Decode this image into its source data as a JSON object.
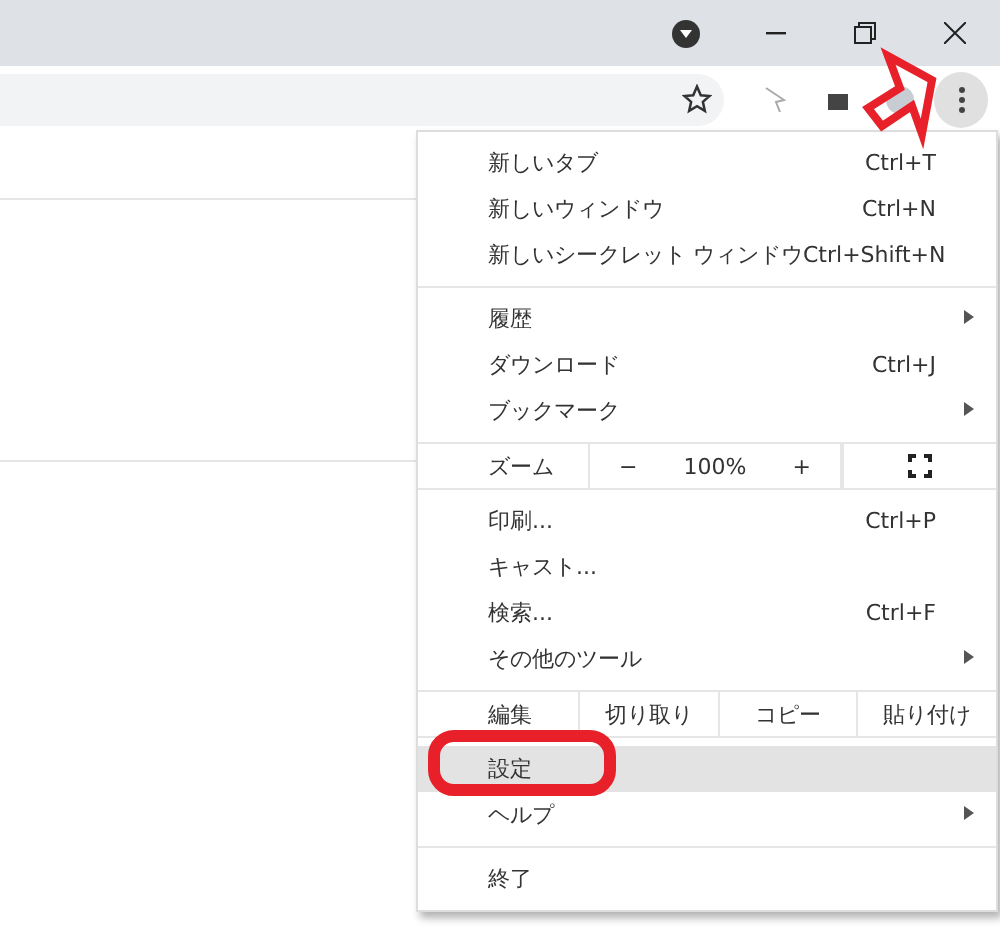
{
  "toolbar": {
    "menu_button_active": true
  },
  "menu": {
    "items": [
      {
        "kind": "item",
        "label": "新しいタブ",
        "shortcut": "Ctrl+T",
        "submenu": false,
        "selected": false
      },
      {
        "kind": "item",
        "label": "新しいウィンドウ",
        "shortcut": "Ctrl+N",
        "submenu": false,
        "selected": false
      },
      {
        "kind": "item",
        "label": "新しいシークレット ウィンドウ",
        "shortcut": "Ctrl+Shift+N",
        "submenu": false,
        "selected": false
      },
      {
        "kind": "separator"
      },
      {
        "kind": "item",
        "label": "履歴",
        "submenu": true,
        "selected": false
      },
      {
        "kind": "item",
        "label": "ダウンロード",
        "shortcut": "Ctrl+J",
        "submenu": false,
        "selected": false
      },
      {
        "kind": "item",
        "label": "ブックマーク",
        "submenu": true,
        "selected": false
      },
      {
        "kind": "zoom",
        "label": "ズーム",
        "minus": "−",
        "value": "100%",
        "plus": "+"
      },
      {
        "kind": "item",
        "label": "印刷...",
        "shortcut": "Ctrl+P",
        "submenu": false,
        "selected": false
      },
      {
        "kind": "item",
        "label": "キャスト...",
        "submenu": false,
        "selected": false
      },
      {
        "kind": "item",
        "label": "検索...",
        "shortcut": "Ctrl+F",
        "submenu": false,
        "selected": false
      },
      {
        "kind": "item",
        "label": "その他のツール",
        "submenu": true,
        "selected": false
      },
      {
        "kind": "edit",
        "label": "編集",
        "actions": [
          "切り取り",
          "コピー",
          "貼り付け"
        ]
      },
      {
        "kind": "item",
        "label": "設定",
        "submenu": false,
        "selected": true
      },
      {
        "kind": "item",
        "label": "ヘルプ",
        "submenu": true,
        "selected": false
      },
      {
        "kind": "separator"
      },
      {
        "kind": "item",
        "label": "終了",
        "submenu": false,
        "selected": false
      }
    ]
  }
}
